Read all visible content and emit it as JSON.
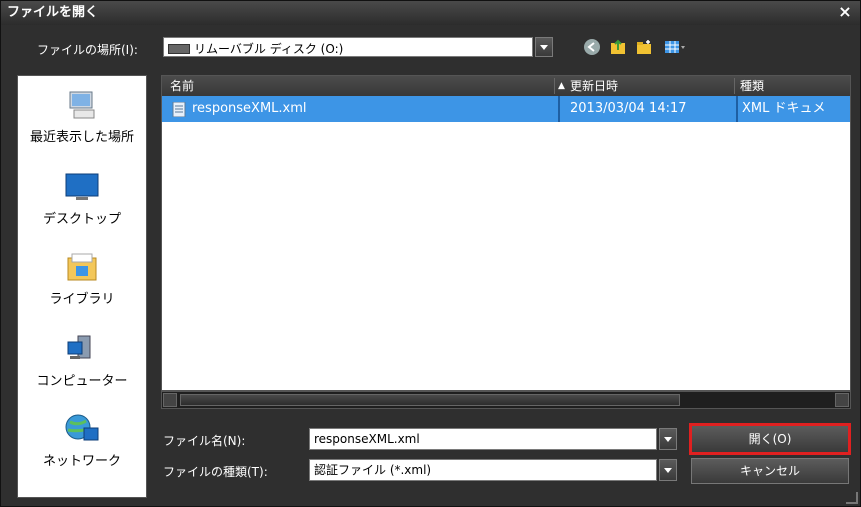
{
  "window": {
    "title": "ファイルを開く",
    "close_label": "×"
  },
  "lookin": {
    "label": "ファイルの場所(I):",
    "value": "リムーバブル ディスク (O:)"
  },
  "sidebar": {
    "items": [
      {
        "label": "最近表示した場所",
        "icon": "recent-places-icon"
      },
      {
        "label": "デスクトップ",
        "icon": "desktop-icon"
      },
      {
        "label": "ライブラリ",
        "icon": "libraries-icon"
      },
      {
        "label": "コンピューター",
        "icon": "computer-icon"
      },
      {
        "label": "ネットワーク",
        "icon": "network-icon"
      }
    ]
  },
  "filelist": {
    "columns": {
      "name": "名前",
      "date": "更新日時",
      "type": "種類"
    },
    "sort_indicator": "▲",
    "files": [
      {
        "name": "responseXML.xml",
        "date": "2013/03/04 14:17",
        "type": "XML ドキュメ"
      }
    ]
  },
  "filename": {
    "label": "ファイル名(N):",
    "value": "responseXML.xml"
  },
  "filetype": {
    "label": "ファイルの種類(T):",
    "value": "認証ファイル (*.xml)"
  },
  "buttons": {
    "open": "開く(O)",
    "cancel": "キャンセル"
  },
  "colors": {
    "selection": "#3d95e6",
    "highlight_border": "#e02020",
    "dialog_bg": "#2f2f2f"
  }
}
